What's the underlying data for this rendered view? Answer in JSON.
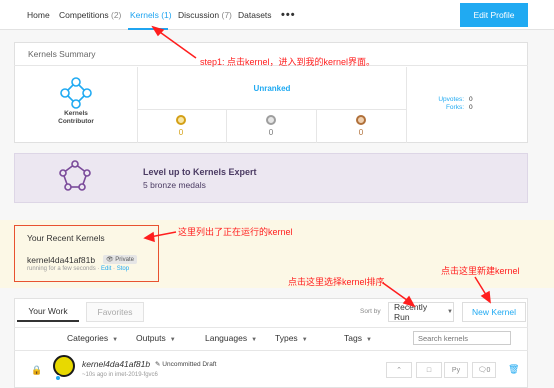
{
  "nav": {
    "items": [
      {
        "label": "Home",
        "count": ""
      },
      {
        "label": "Competitions",
        "count": "(2)"
      },
      {
        "label": "Kernels",
        "count": "(1)"
      },
      {
        "label": "Discussion",
        "count": "(7)"
      },
      {
        "label": "Datasets",
        "count": ""
      }
    ],
    "more": "•••",
    "edit_profile": "Edit Profile"
  },
  "summary": {
    "title": "Kernels Summary",
    "contributor_label": "Kernels\nContributor",
    "rank": "Unranked",
    "medals": [
      {
        "kind": "gold",
        "count": "0"
      },
      {
        "kind": "silver",
        "count": "0"
      },
      {
        "kind": "bronze",
        "count": "0"
      }
    ],
    "upvotes_label": "Upvotes:",
    "upvotes": "0",
    "forks_label": "Forks:",
    "forks": "0"
  },
  "levelup": {
    "title": "Level up to Kernels Expert",
    "subtitle": "5 bronze medals"
  },
  "recent": {
    "title": "Your Recent Kernels",
    "kernel_name": "kernel4da41af81b",
    "badge": "Private",
    "status": "running for a few seconds · ",
    "edit": "Edit",
    "sep": " · ",
    "stop": "Stop"
  },
  "work": {
    "tab_your_work": "Your Work",
    "tab_favorites": "Favorites",
    "sort_by": "Sort by",
    "sort_value": "Recently Run",
    "new_kernel": "New Kernel",
    "filters": [
      "Categories",
      "Outputs",
      "Languages",
      "Types",
      "Tags"
    ],
    "search_placeholder": "Search kernels"
  },
  "row": {
    "title": "kernel4da41af81b",
    "draft": "Uncommitted Draft",
    "meta": "~10s ago in imet-2019-fgvc6",
    "lang": "Py",
    "comments": "0"
  },
  "annotations": {
    "step1": "step1: 点击kernel，进入到我的kernel界面。",
    "running": "这里列出了正在运行的kernel",
    "sort": "点击这里选择kernel排序",
    "new": "点击这里新建kernel"
  },
  "colors": {
    "accent": "#20aaf2",
    "annotation": "#ff1e1e",
    "gold": "#d4a017",
    "silver": "#9e9e9e",
    "bronze": "#b0703a"
  }
}
